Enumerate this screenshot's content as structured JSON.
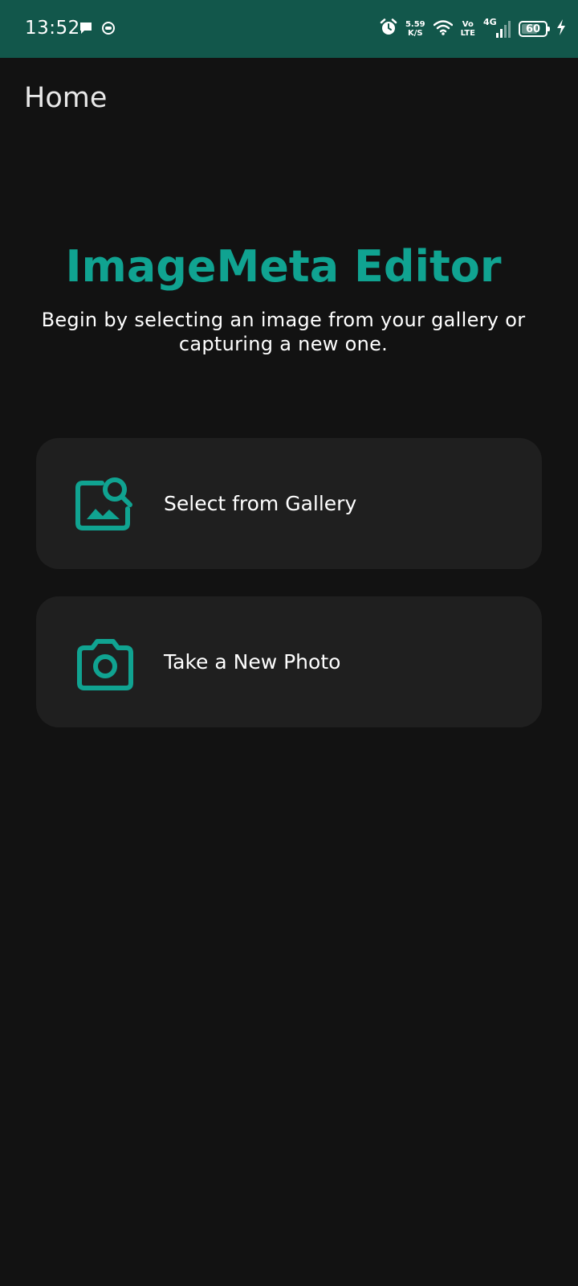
{
  "status_bar": {
    "time": "13:52",
    "net_speed_value": "5.59",
    "net_speed_unit": "K/S",
    "volte_top": "Vo",
    "volte_bottom": "LTE",
    "network_type": "4G",
    "battery_level": "60",
    "icons": [
      "message-icon",
      "notification-icon",
      "alarm-icon",
      "wifi-icon",
      "signal-icon",
      "battery-icon",
      "charging-icon"
    ]
  },
  "app_bar": {
    "title": "Home"
  },
  "main": {
    "title": "ImageMeta Editor",
    "subtitle": "Begin by selecting an image from your gallery or capturing a new one.",
    "actions": [
      {
        "label": "Select from Gallery",
        "icon": "image-search-icon"
      },
      {
        "label": "Take a New Photo",
        "icon": "camera-icon"
      }
    ]
  },
  "colors": {
    "status_bar_bg": "#12574B",
    "background": "#121212",
    "card_bg": "#1F1F1F",
    "accent": "#10A391",
    "text_primary": "#FFFFFF"
  }
}
